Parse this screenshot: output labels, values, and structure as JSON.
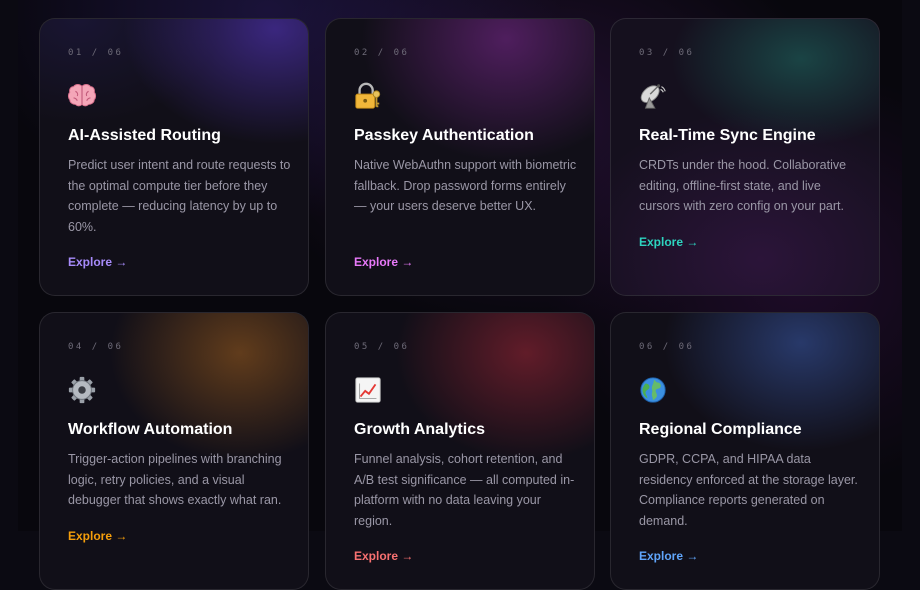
{
  "features": [
    {
      "index": "01 / 06",
      "icon": "brain-icon",
      "title": "AI-Assisted Routing",
      "description": "Predict user intent and route requests to the optimal compute tier before they complete — reducing latency by up to 60%.",
      "cta": "Explore →",
      "accent": "#a78bfa"
    },
    {
      "index": "02 / 06",
      "icon": "lock-with-key-icon",
      "title": "Passkey Authentication",
      "description": "Native WebAuthn support with biometric fallback. Drop password forms entirely — your users deserve better UX.",
      "cta": "Explore →",
      "accent": "#e879f9"
    },
    {
      "index": "03 / 06",
      "icon": "satellite-antenna-icon",
      "title": "Real-Time Sync Engine",
      "description": "CRDTs under the hood. Collaborative editing, offline-first state, and live cursors with zero config on your part.",
      "cta": "Explore →",
      "accent": "#2dd4bf"
    },
    {
      "index": "04 / 06",
      "icon": "gear-icon",
      "title": "Workflow Automation",
      "description": "Trigger-action pipelines with branching logic, retry policies, and a visual debugger that shows exactly what ran.",
      "cta": "Explore →",
      "accent": "#f59e0b"
    },
    {
      "index": "05 / 06",
      "icon": "chart-increasing-icon",
      "title": "Growth Analytics",
      "description": "Funnel analysis, cohort retention, and A/B test significance — all computed in-platform with no data leaving your region.",
      "cta": "Explore →",
      "accent": "#f87171"
    },
    {
      "index": "06 / 06",
      "icon": "globe-icon",
      "title": "Regional Compliance",
      "description": "GDPR, CCPA, and HIPAA data residency enforced at the storage layer. Compliance reports generated on demand.",
      "cta": "Explore →",
      "accent": "#60a5fa"
    }
  ]
}
